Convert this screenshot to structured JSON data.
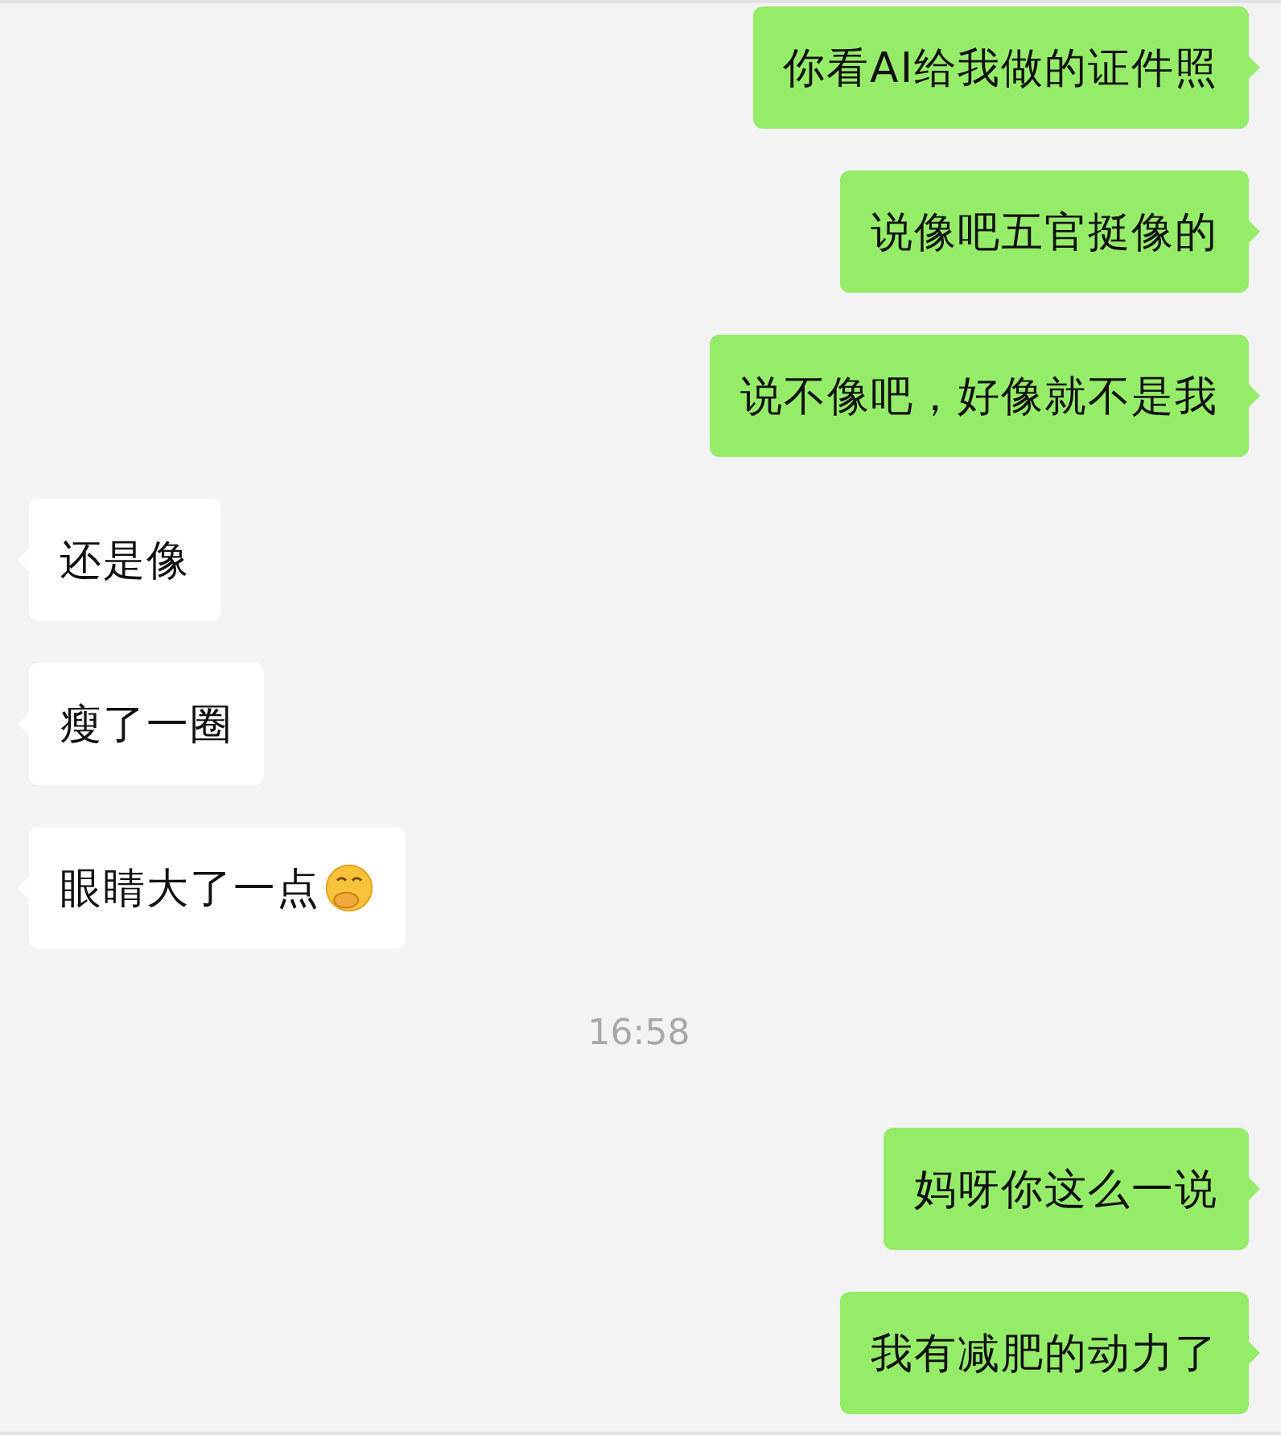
{
  "messages": [
    {
      "kind": "sent",
      "text": "你看AI给我做的证件照"
    },
    {
      "kind": "sent",
      "text": "说像吧五官挺像的"
    },
    {
      "kind": "sent",
      "text": "说不像吧，好像就不是我"
    },
    {
      "kind": "received",
      "text": "还是像"
    },
    {
      "kind": "received",
      "text": "瘦了一圈"
    },
    {
      "kind": "received",
      "text": "眼睛大了一点",
      "emoji": true
    },
    {
      "kind": "time",
      "text": "16:58"
    },
    {
      "kind": "sent",
      "text": "妈呀你这么一说"
    },
    {
      "kind": "sent",
      "text": "我有减肥的动力了"
    }
  ]
}
